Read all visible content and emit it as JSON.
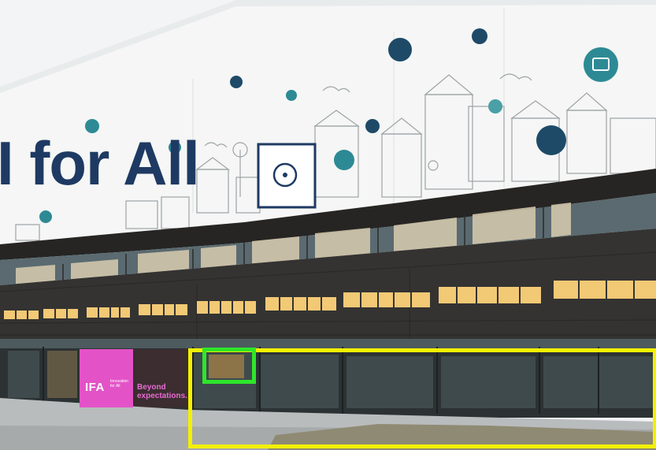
{
  "banner": {
    "headline": "I for All"
  },
  "ifa_sign": {
    "logo": "IFA",
    "small_text": "Innovation for All",
    "tagline": "Beyond expectations."
  },
  "annotations": {
    "yellow_box_color": "#f3f000",
    "green_box_color": "#2ee62a"
  },
  "colors": {
    "banner_text": "#1e3a63",
    "teal_icon": "#2d8a95",
    "navy_icon": "#1e4a68",
    "facade_dark": "#343332",
    "window_light": "#f2c975",
    "ifa_pink": "#e353c7"
  }
}
